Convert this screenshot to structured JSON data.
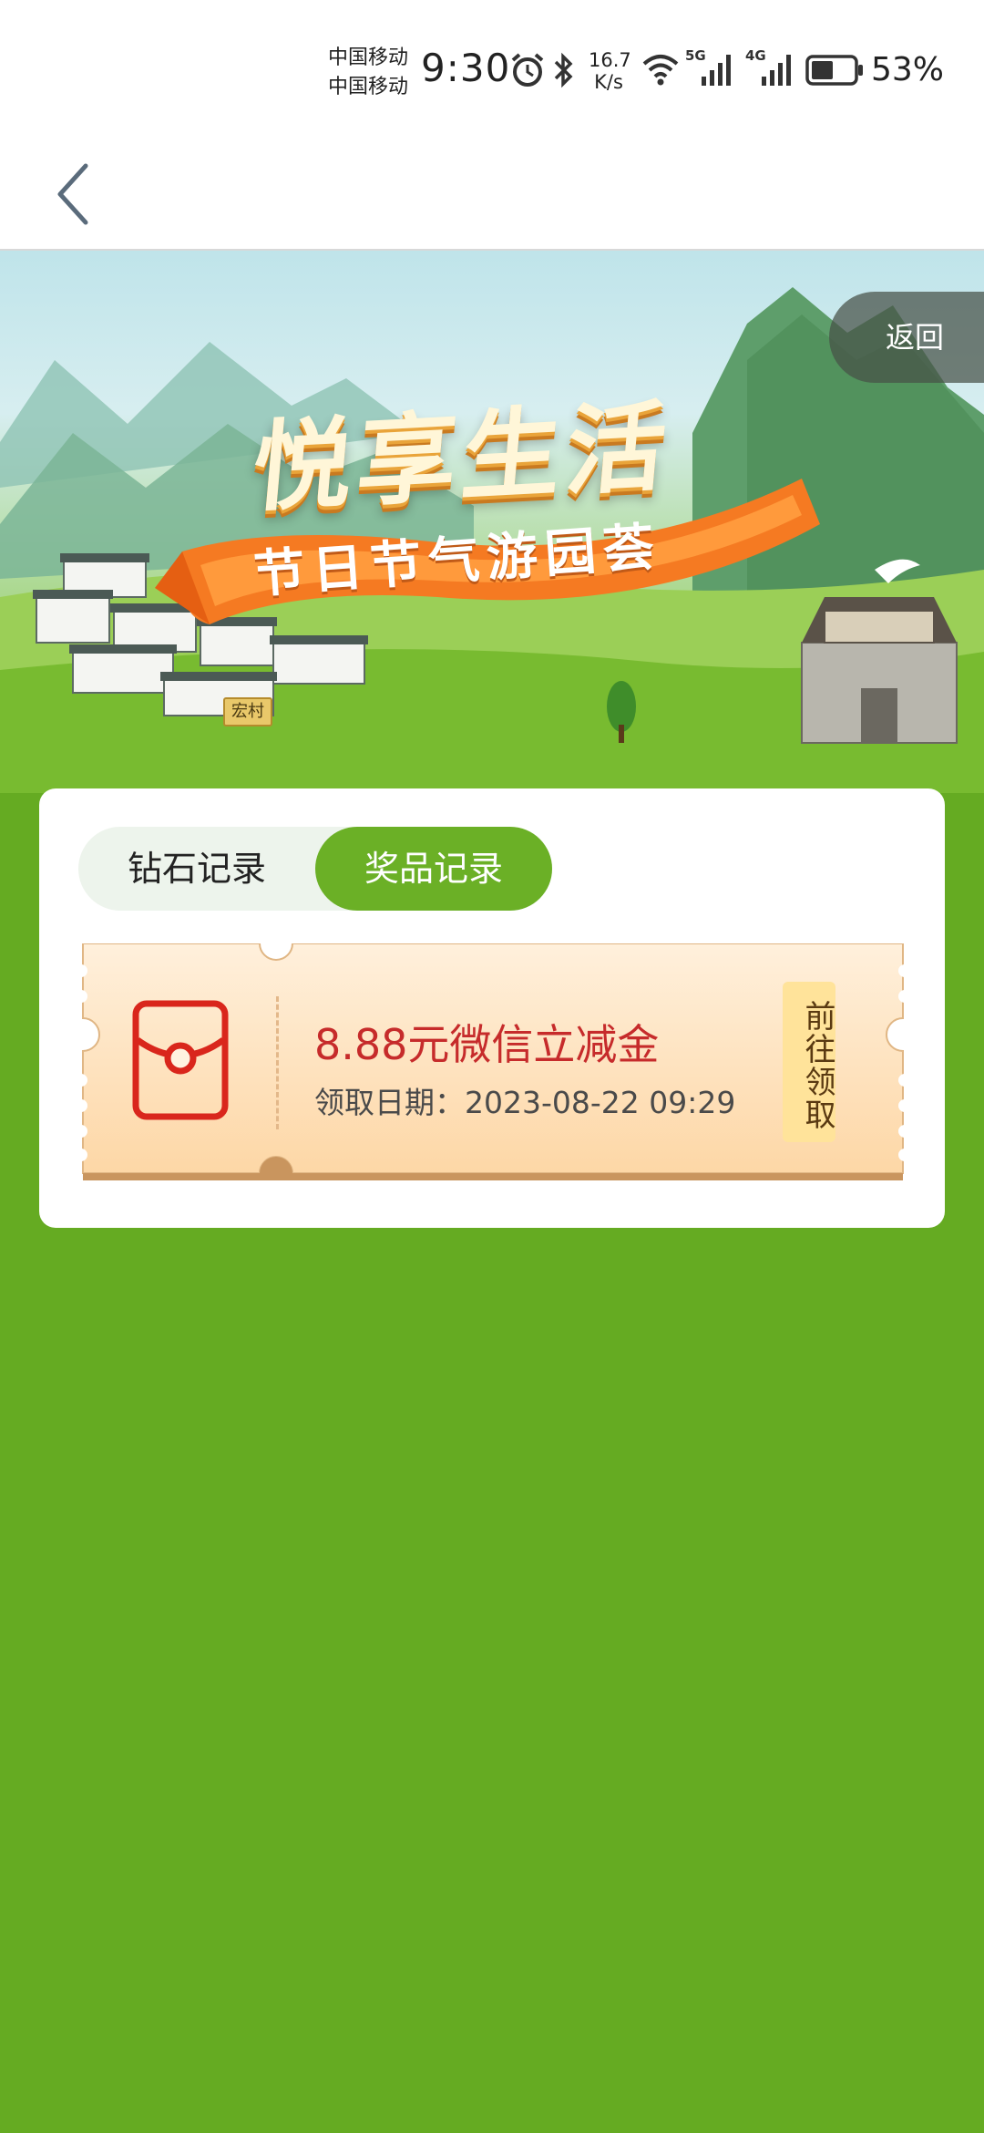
{
  "status_bar": {
    "carrier_1": "中国移动",
    "carrier_2": "中国移动",
    "time": "9:30",
    "net_speed_value": "16.7",
    "net_speed_unit": "K/s",
    "signal_1_label": "5G",
    "signal_2_label": "4G",
    "battery_percent": "53%",
    "battery_level": 0.53
  },
  "nav": {
    "back_icon": "chevron-left-icon"
  },
  "banner": {
    "title": "悦享生活",
    "subtitle": "节日节气游园荟",
    "village_sign": "宏村",
    "return_label": "返回"
  },
  "record_card": {
    "tabs": [
      {
        "label": "钻石记录",
        "active": false
      },
      {
        "label": "奖品记录",
        "active": true
      }
    ],
    "records": [
      {
        "icon": "red-packet-icon",
        "prize_name": "8.88元微信立减金",
        "claim_date": "领取日期：2023-08-22 09:29",
        "action_label": "前往领取"
      }
    ]
  },
  "colors": {
    "page_background": "#65ab22",
    "tab_active": "#6bb026",
    "prize_text": "#c62b2b",
    "claim_button": "#ffe39a",
    "ticket_background": "#fde3bf"
  }
}
